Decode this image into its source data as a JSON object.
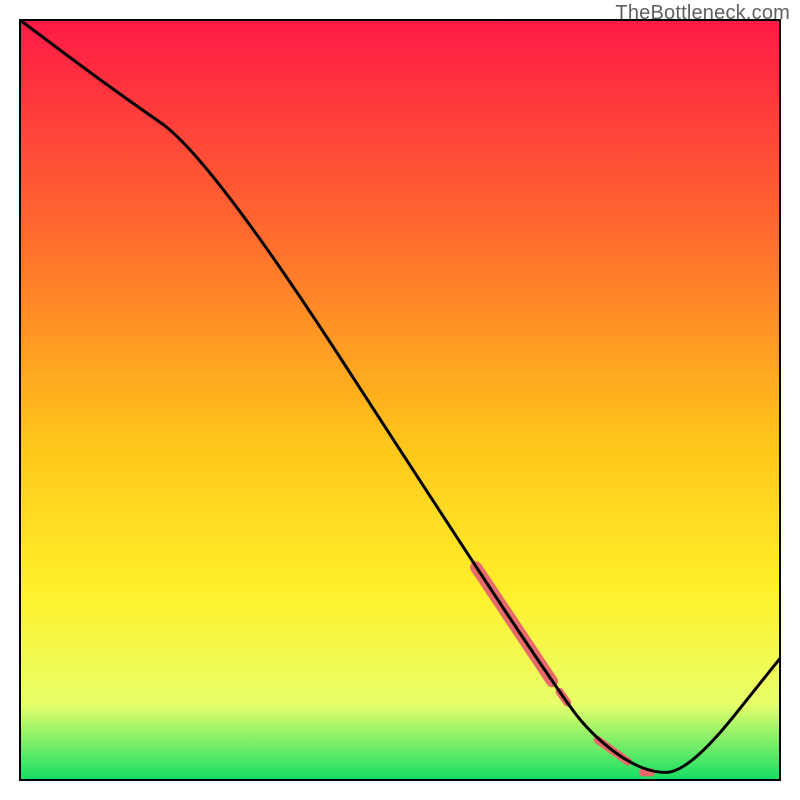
{
  "watermark": "TheBottleneck.com",
  "colors": {
    "gradient_top": "#ff1a46",
    "gradient_mid1": "#ff6a2e",
    "gradient_mid2": "#ffc41a",
    "gradient_mid3": "#fff02a",
    "gradient_mid4": "#e8ff6a",
    "gradient_bottom": "#14de66",
    "curve": "#000000",
    "highlight": "#e96a6a",
    "frame": "#000000"
  },
  "chart_data": {
    "type": "line",
    "title": "",
    "xlabel": "",
    "ylabel": "",
    "xlim": [
      0,
      100
    ],
    "ylim": [
      0,
      100
    ],
    "grid": false,
    "legend": false,
    "series": [
      {
        "name": "bottleneck-curve",
        "x": [
          0,
          12,
          25,
          60,
          70,
          75,
          82,
          88,
          100
        ],
        "y": [
          100,
          91,
          82,
          28,
          13,
          6,
          1,
          1,
          16
        ]
      }
    ],
    "highlight_segments": [
      {
        "name": "thick-band",
        "x_start": 60,
        "x_end": 70,
        "thickness": 12
      },
      {
        "name": "dot-1",
        "x_start": 71,
        "x_end": 72,
        "thickness": 8
      },
      {
        "name": "dot-2",
        "x_start": 76,
        "x_end": 80,
        "thickness": 8
      },
      {
        "name": "dot-3",
        "x_start": 82,
        "x_end": 83,
        "thickness": 8
      }
    ]
  }
}
